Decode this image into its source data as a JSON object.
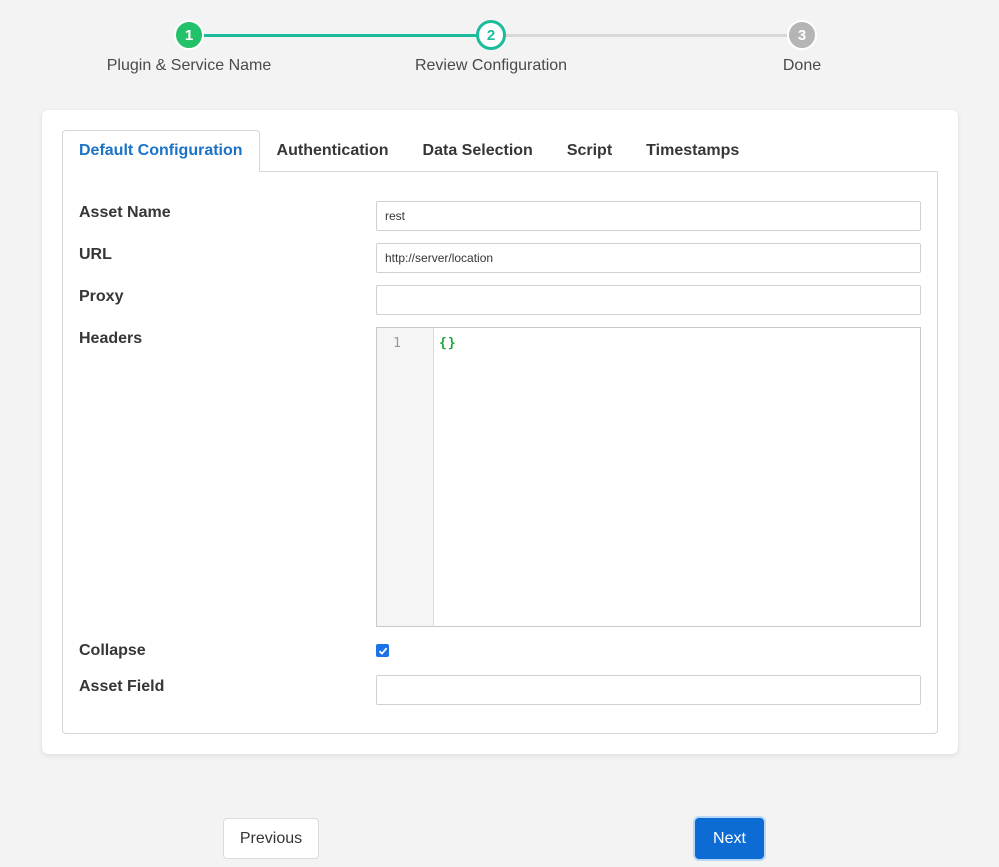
{
  "stepper": {
    "steps": [
      {
        "number": "1",
        "label": "Plugin & Service Name",
        "state": "completed"
      },
      {
        "number": "2",
        "label": "Review Configuration",
        "state": "active"
      },
      {
        "number": "3",
        "label": "Done",
        "state": "pending"
      }
    ],
    "colors": {
      "completed": "#23c26a",
      "active": "#1abc9c",
      "pending": "#b5b5b5"
    }
  },
  "tabs": [
    {
      "label": "Default Configuration",
      "active": true
    },
    {
      "label": "Authentication",
      "active": false
    },
    {
      "label": "Data Selection",
      "active": false
    },
    {
      "label": "Script",
      "active": false
    },
    {
      "label": "Timestamps",
      "active": false
    }
  ],
  "form": {
    "asset_name": {
      "label": "Asset Name",
      "value": "rest"
    },
    "url": {
      "label": "URL",
      "value": "http://server/location"
    },
    "proxy": {
      "label": "Proxy",
      "value": ""
    },
    "headers": {
      "label": "Headers",
      "line_number": "1",
      "code": "{}"
    },
    "collapse": {
      "label": "Collapse",
      "checked": true
    },
    "asset_field": {
      "label": "Asset Field",
      "value": ""
    }
  },
  "buttons": {
    "previous": "Previous",
    "next": "Next"
  },
  "accent_color": "#0c6cd4"
}
